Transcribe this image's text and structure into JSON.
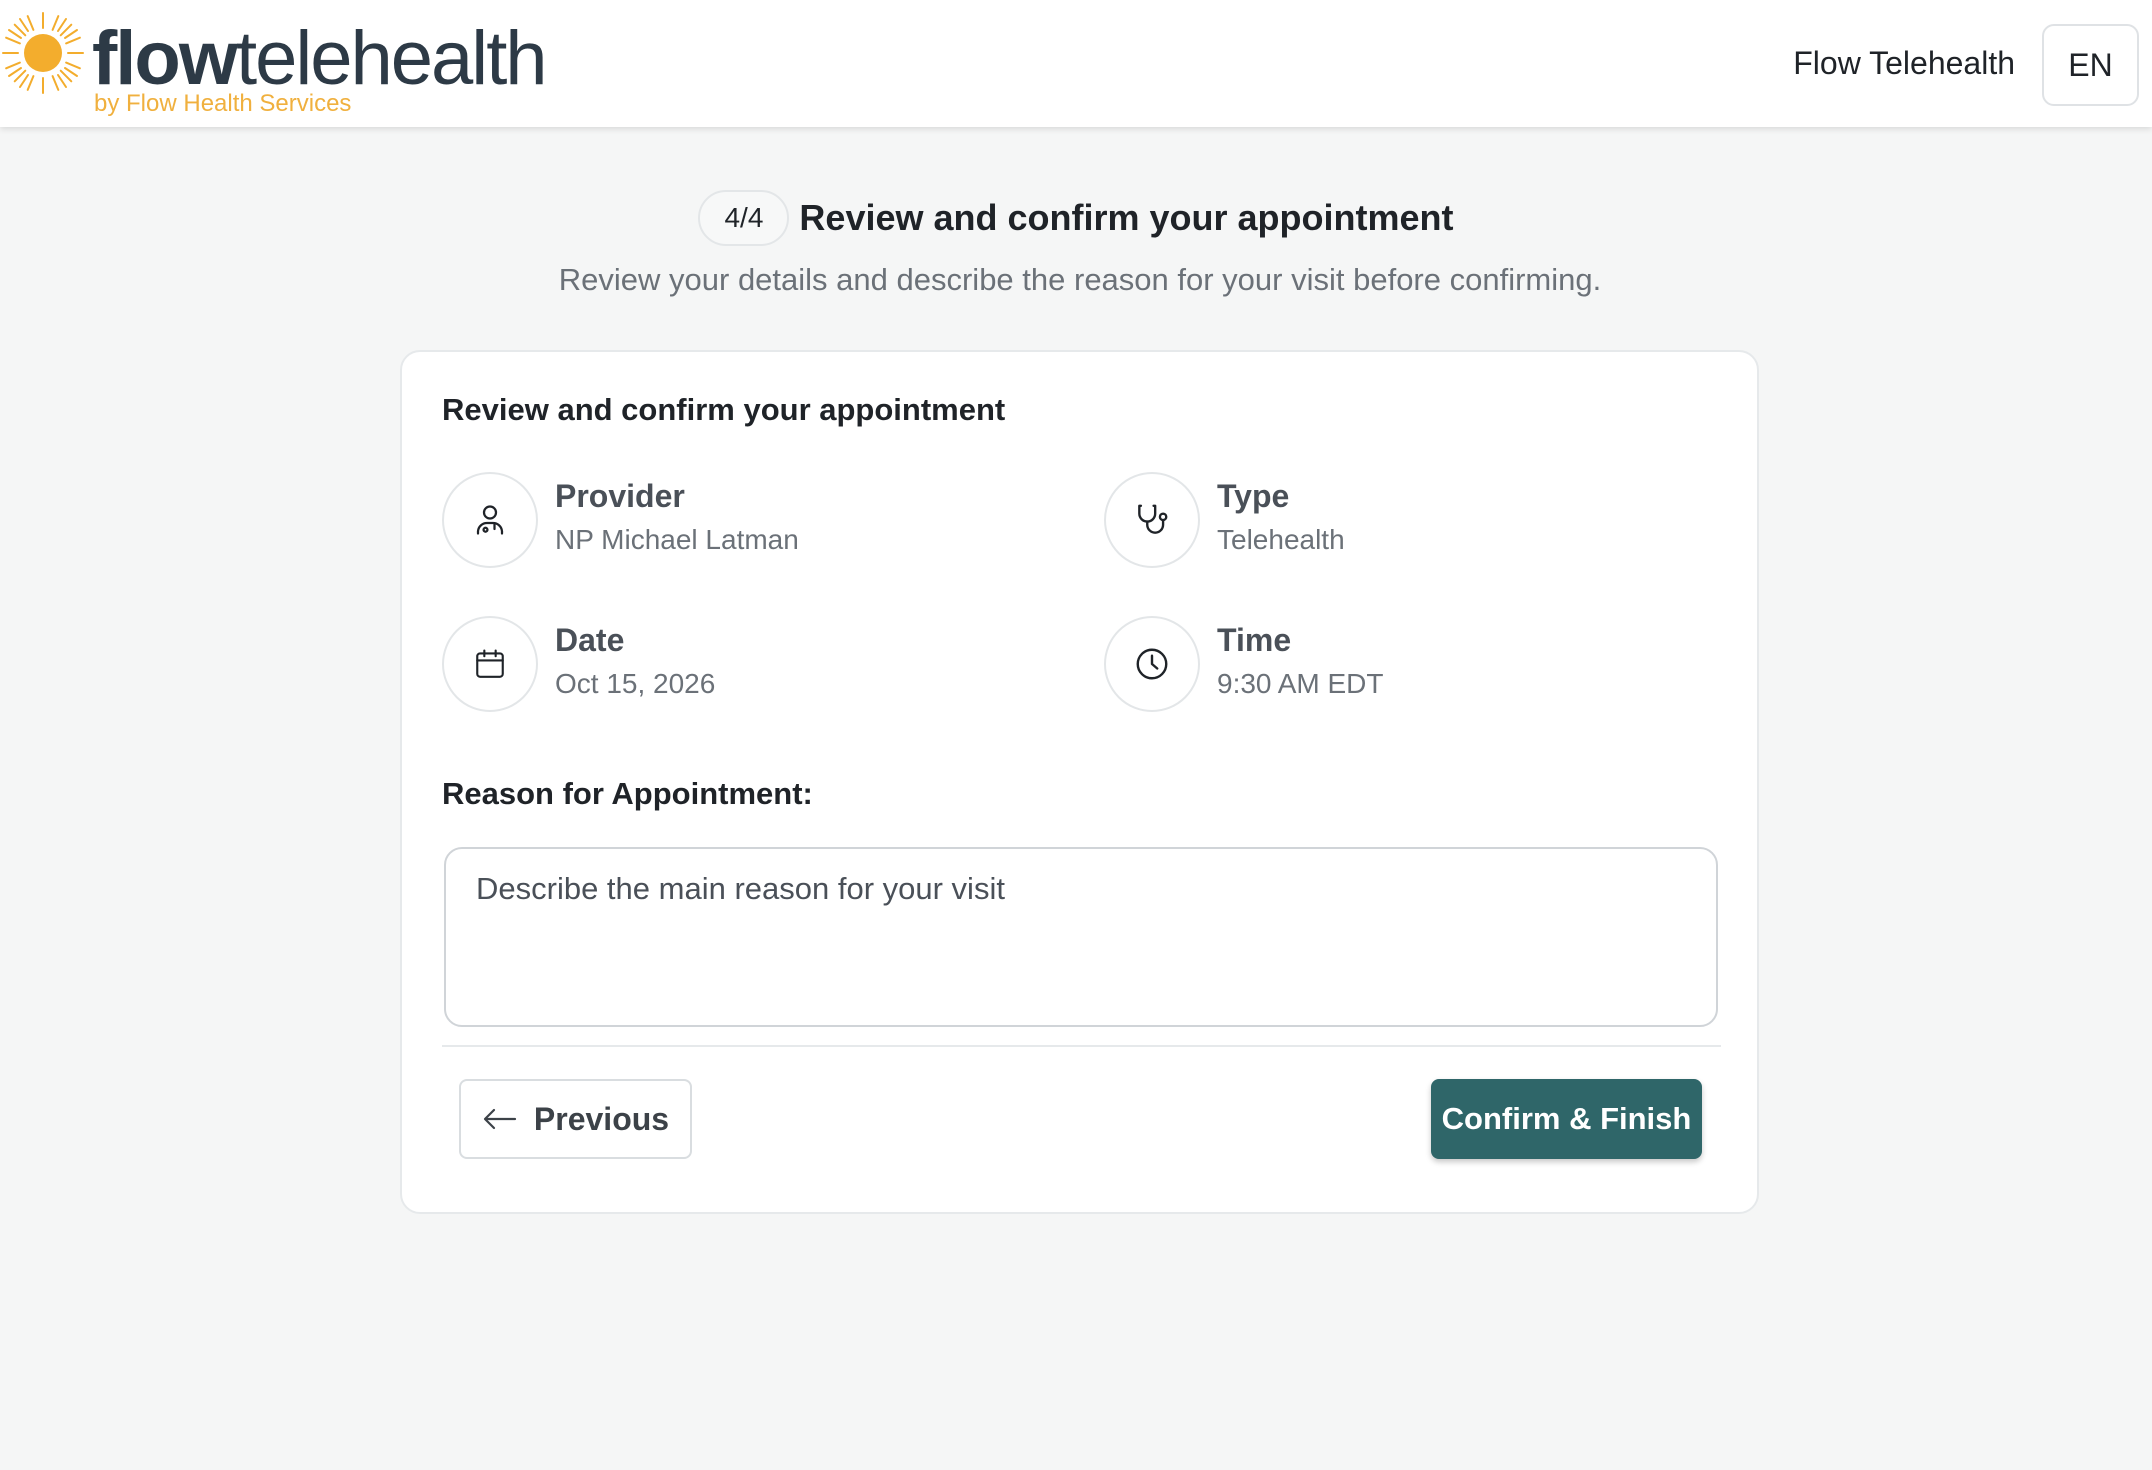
{
  "header": {
    "logo_word_bold": "flow",
    "logo_word_light": "telehealth",
    "logo_tagline": "by Flow Health Services",
    "brand_link": "Flow Telehealth",
    "language": "EN"
  },
  "step": {
    "indicator": "4/4",
    "title": "Review and confirm your appointment",
    "subtitle": "Review your details and describe the reason for your visit before confirming."
  },
  "card": {
    "title": "Review and confirm your appointment",
    "details": [
      {
        "label": "Provider",
        "value": "NP Michael Latman",
        "icon": "doctor-icon"
      },
      {
        "label": "Type",
        "value": "Telehealth",
        "icon": "stethoscope-icon"
      },
      {
        "label": "Date",
        "value": "Oct 15, 2026",
        "icon": "calendar-icon"
      },
      {
        "label": "Time",
        "value": "9:30 AM EDT",
        "icon": "clock-icon"
      }
    ],
    "reason_label": "Reason for Appointment:",
    "reason_placeholder": "Describe the main reason for your visit",
    "reason_value": ""
  },
  "actions": {
    "previous_label": "Previous",
    "confirm_label": "Confirm & Finish"
  },
  "colors": {
    "primary": "#2f6669",
    "logo_sun": "#f3ad2d",
    "background": "#f5f6f6"
  }
}
